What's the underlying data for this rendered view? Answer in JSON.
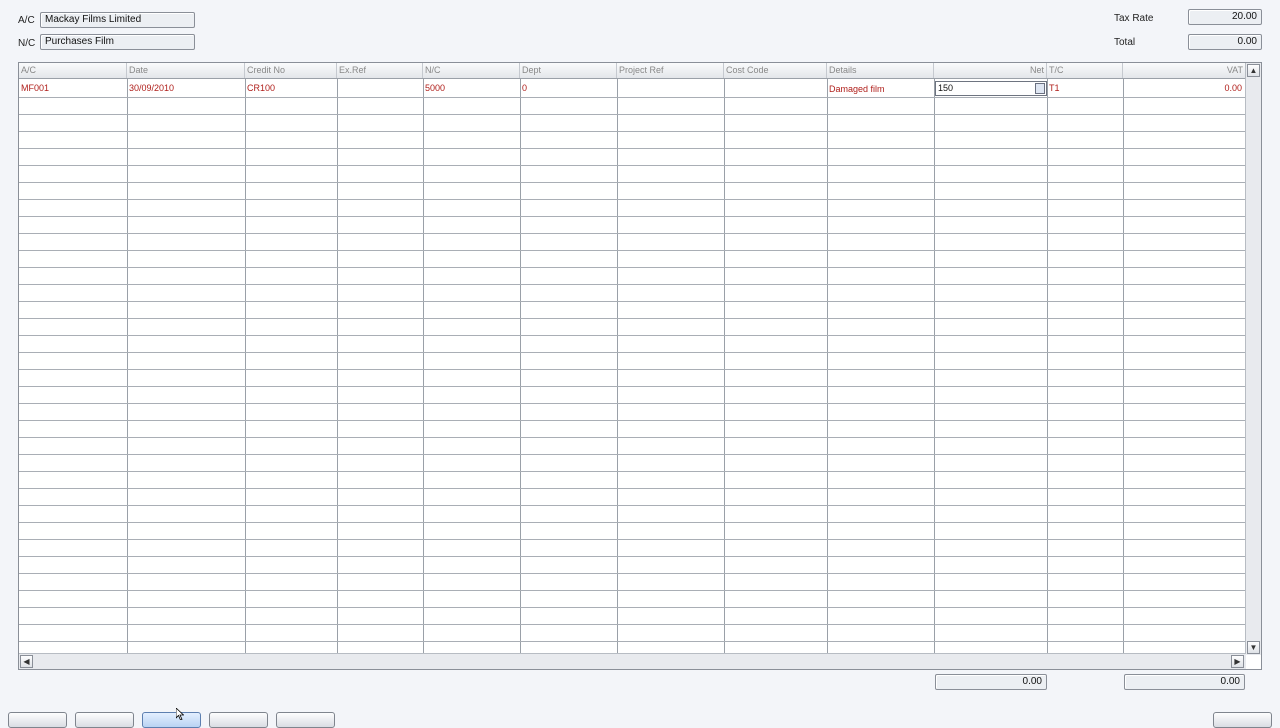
{
  "header": {
    "ac_label": "A/C",
    "ac_value": "Mackay Films Limited",
    "nc_label": "N/C",
    "nc_value": "Purchases Film",
    "tax_rate_label": "Tax Rate",
    "tax_rate_value": "20.00",
    "total_label": "Total",
    "total_value": "0.00"
  },
  "grid": {
    "columns": [
      "A/C",
      "Date",
      "Credit No",
      "Ex.Ref",
      "N/C",
      "Dept",
      "Project Ref",
      "Cost Code",
      "Details",
      "Net",
      "T/C",
      "VAT"
    ],
    "row1": {
      "ac": "MF001",
      "date": "30/09/2010",
      "credit_no": "CR100",
      "ex_ref": "",
      "nc": "5000",
      "dept": "0",
      "project_ref": "",
      "cost_code": "",
      "details": "Damaged film",
      "net": "150",
      "tc": "T1",
      "vat": "0.00"
    },
    "row_color": "#b0201c"
  },
  "footer": {
    "net_total": "0.00",
    "vat_total": "0.00"
  },
  "icons": {
    "calculator": "calculator-icon",
    "scroll_left": "scroll-left-icon",
    "scroll_right": "scroll-right-icon",
    "scroll_up": "scroll-up-icon",
    "scroll_down": "scroll-down-icon"
  }
}
